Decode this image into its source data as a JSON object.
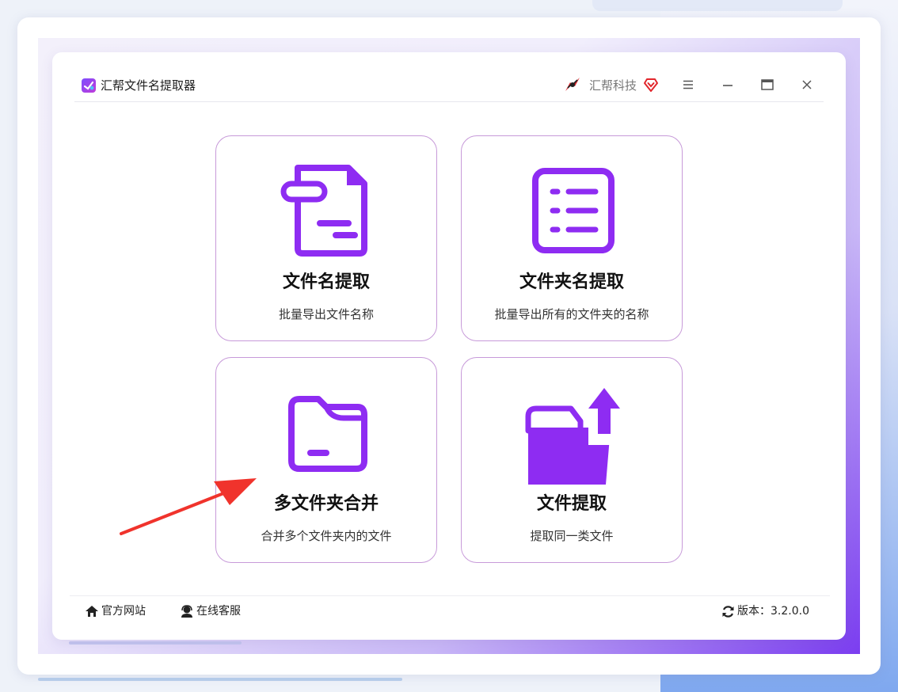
{
  "window": {
    "title": "汇帮文件名提取器",
    "brand": "汇帮科技",
    "controls": [
      "menu-icon",
      "minimize-icon",
      "maximize-icon",
      "close-icon"
    ]
  },
  "cards": [
    {
      "title": "文件名提取",
      "desc": "批量导出文件名称",
      "icon": "file-document-icon"
    },
    {
      "title": "文件夹名提取",
      "desc": "批量导出所有的文件夹的名称",
      "icon": "list-document-icon"
    },
    {
      "title": "多文件夹合并",
      "desc": "合并多个文件夹内的文件",
      "icon": "folder-icon"
    },
    {
      "title": "文件提取",
      "desc": "提取同一类文件",
      "icon": "folder-upload-icon"
    }
  ],
  "footer": {
    "site": "官方网站",
    "service": "在线客服",
    "version": "版本：3.2.0.0"
  },
  "colors": {
    "accent": "#8e2cf2",
    "card_border": "#c79ad9",
    "annotation_arrow": "#f0332c"
  }
}
